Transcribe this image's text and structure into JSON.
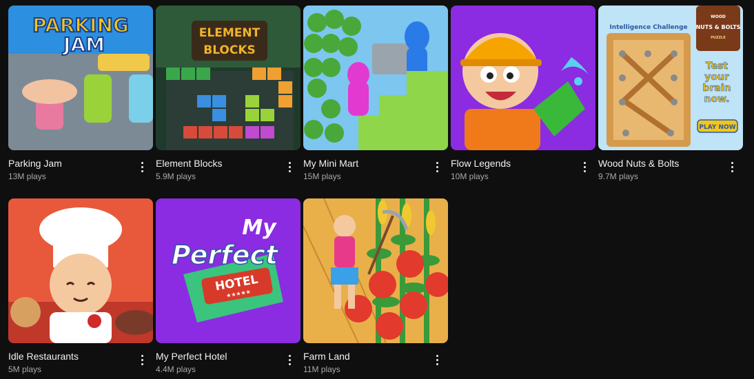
{
  "games": [
    {
      "title": "Parking Jam",
      "plays": "13M plays",
      "art_text": [
        "PARKING",
        "JAM"
      ],
      "colors": {
        "bg": "#2d8fe0",
        "accent": "#f5c518"
      }
    },
    {
      "title": "Element Blocks",
      "plays": "5.9M plays",
      "art_text": [
        "ELEMENT",
        "BLOCKS"
      ],
      "colors": {
        "bg": "#1f3a2a",
        "accent": "#f0b429"
      }
    },
    {
      "title": "My Mini Mart",
      "plays": "15M plays",
      "art_text": [],
      "colors": {
        "bg": "#7cc6ef",
        "accent": "#3f8f2f"
      }
    },
    {
      "title": "Flow Legends",
      "plays": "10M plays",
      "art_text": [],
      "colors": {
        "bg": "#8b2be2",
        "accent": "#f5a400"
      }
    },
    {
      "title": "Wood Nuts & Bolts",
      "plays": "9.7M plays",
      "art_text": [
        "Intelligence Challenge",
        "WOOD",
        "NUTS & BOLTS",
        "PUZZLE",
        "Test",
        "your",
        "brain",
        "now.",
        "PLAY NOW"
      ],
      "colors": {
        "bg": "#bfe3f7",
        "accent": "#d59a4b"
      }
    },
    {
      "title": "Idle Restaurants",
      "plays": "5M plays",
      "art_text": [],
      "colors": {
        "bg": "#e8583b",
        "accent": "#ffffff"
      }
    },
    {
      "title": "My Perfect Hotel",
      "plays": "4.4M plays",
      "art_text": [
        "My",
        "Perfect",
        "HOTEL",
        "★★★★★"
      ],
      "colors": {
        "bg": "#8b2be2",
        "accent": "#3ac47d"
      }
    },
    {
      "title": "Farm Land",
      "plays": "11M plays",
      "art_text": [],
      "colors": {
        "bg": "#e9b04a",
        "accent": "#e23a2c"
      }
    }
  ]
}
